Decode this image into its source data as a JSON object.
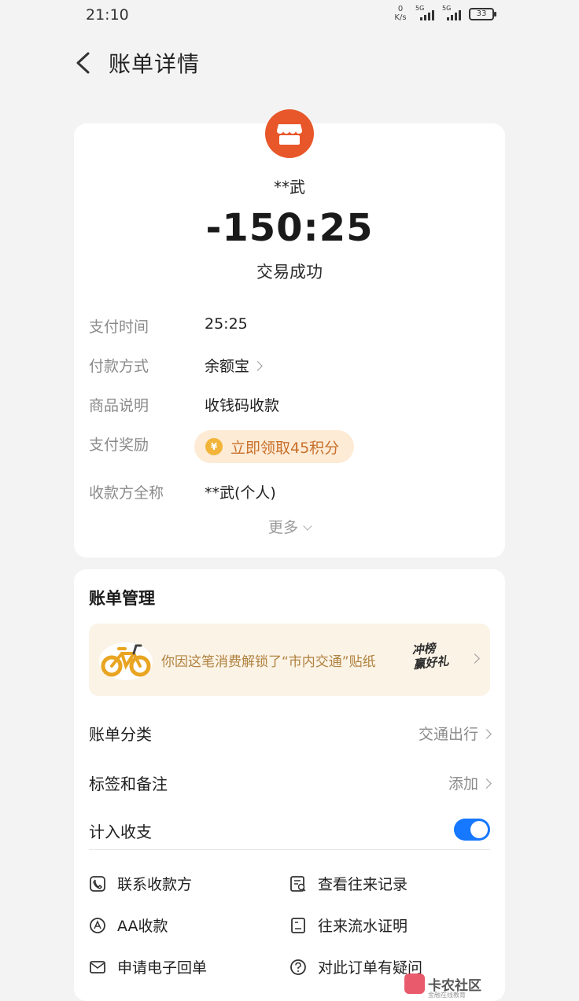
{
  "status_bar": {
    "time": "21:10",
    "net_speed_value": "0",
    "net_speed_unit": "K/s",
    "signal_1": "5G",
    "signal_2": "5G",
    "battery": "33"
  },
  "header": {
    "title": "账单详情",
    "back_icon": "chevron-left-icon"
  },
  "transaction": {
    "merchant_icon": "shop-icon",
    "merchant_color": "#e8572a",
    "merchant_name": "**武",
    "amount": "-150:25",
    "status": "交易成功"
  },
  "details": {
    "pay_time_label": "支付时间",
    "pay_time_value": "25:25",
    "pay_method_label": "付款方式",
    "pay_method_value": "余额宝",
    "goods_label": "商品说明",
    "goods_value": "收钱码收款",
    "reward_label": "支付奖励",
    "reward_value": "立即领取45积分",
    "payee_label": "收款方全称",
    "payee_value": "**武(个人)",
    "more_label": "更多"
  },
  "management": {
    "title": "账单管理",
    "banner_text": "你因这笔消费解锁了“市内交通”贴纸",
    "banner_badge_line1": "冲榜",
    "banner_badge_line2": "赢好礼",
    "category_label": "账单分类",
    "category_value": "交通出行",
    "tags_label": "标签和备注",
    "tags_value": "添加",
    "include_label": "计入收支",
    "include_enabled": true,
    "toggle_color": "#1677ff"
  },
  "actions": [
    {
      "label": "联系收款方",
      "icon": "phone-icon"
    },
    {
      "label": "查看往来记录",
      "icon": "records-search-icon"
    },
    {
      "label": "AA收款",
      "icon": "aa-icon"
    },
    {
      "label": "往来流水证明",
      "icon": "statement-icon"
    },
    {
      "label": "申请电子回单",
      "icon": "mail-icon"
    },
    {
      "label": "对此订单有疑问",
      "icon": "question-icon"
    }
  ],
  "watermark": {
    "text": "卡农社区",
    "sub": "金融在线教育"
  }
}
